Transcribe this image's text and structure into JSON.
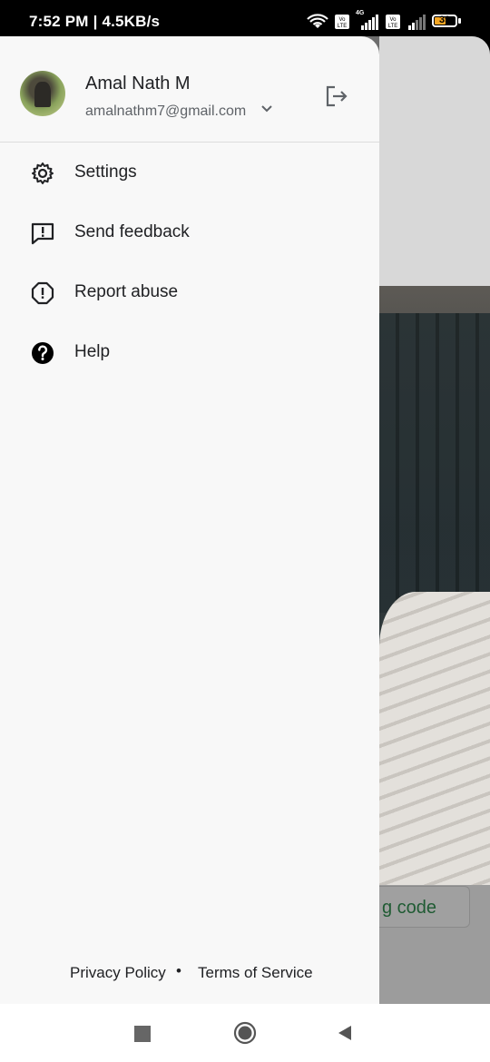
{
  "status_bar": {
    "time_speed": "7:52 PM | 4.5KB/s",
    "battery": "39",
    "network": "4G"
  },
  "account": {
    "name": "Amal Nath M",
    "email": "amalnathm7@gmail.com"
  },
  "menu": [
    {
      "label": "Settings",
      "icon": "gear-icon"
    },
    {
      "label": "Send feedback",
      "icon": "feedback-icon"
    },
    {
      "label": "Report abuse",
      "icon": "report-icon"
    },
    {
      "label": "Help",
      "icon": "help-icon"
    }
  ],
  "footer": {
    "privacy": "Privacy Policy",
    "separator": "•",
    "terms": "Terms of Service"
  },
  "background": {
    "button_text": "g code",
    "button_color": "#1f5b33"
  }
}
